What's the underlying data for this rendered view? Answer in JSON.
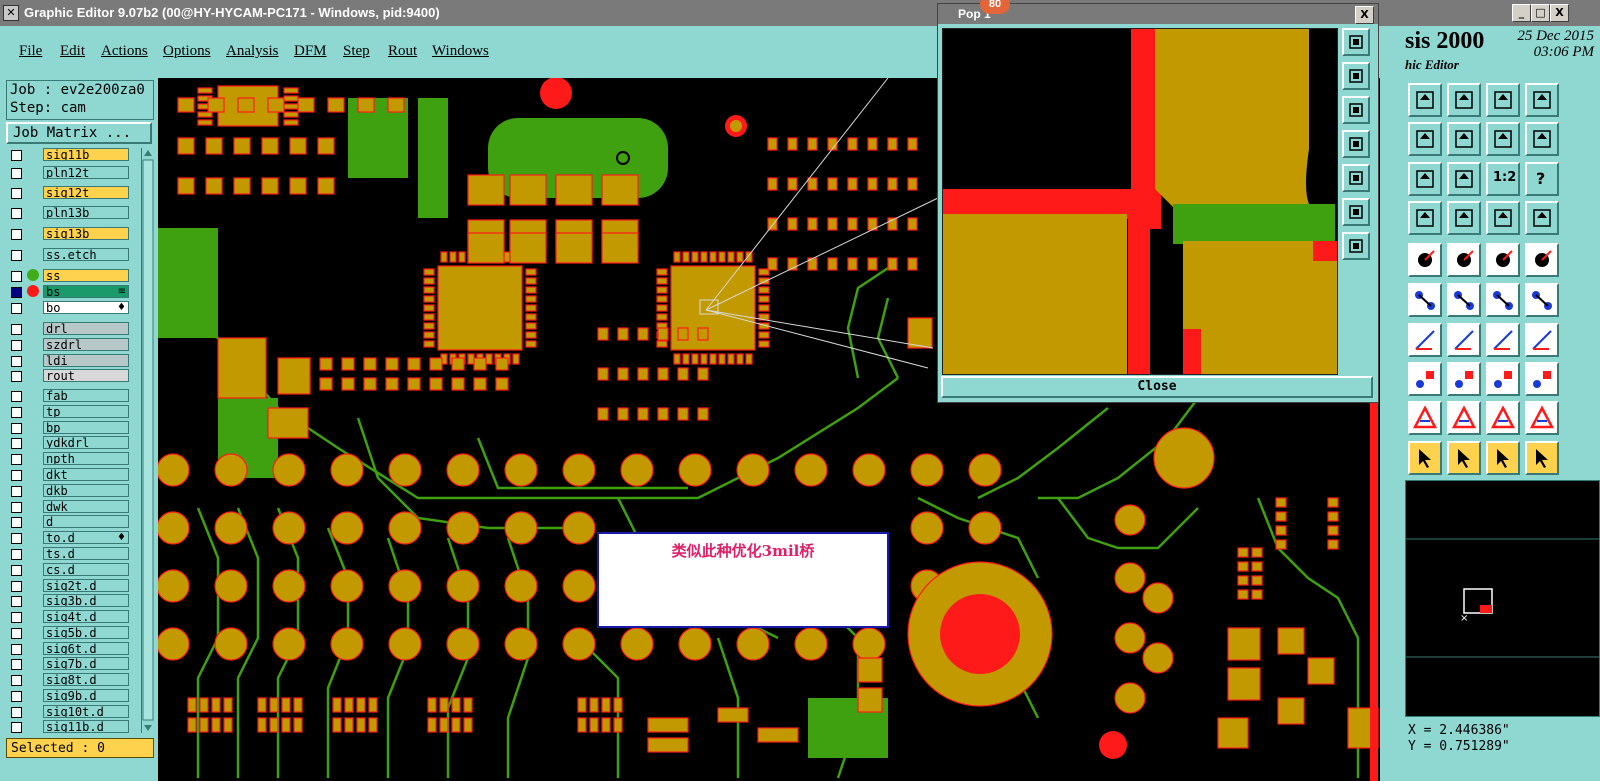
{
  "window": {
    "title": "Graphic Editor 9.07b2 (00@HY-HYCAM-PC171 - Windows, pid:9400)",
    "btn_min": "_",
    "btn_max": "□",
    "btn_close": "X"
  },
  "menu": [
    "File",
    "Edit",
    "Actions",
    "Options",
    "Analysis",
    "DFM",
    "Step",
    "Rout",
    "Windows"
  ],
  "app": {
    "name": "sis 2000",
    "subtitle": "hic Editor",
    "date": "25 Dec 2015",
    "time": "03:06 PM"
  },
  "job": {
    "job_line": "Job : ev2e200za0",
    "step_line": "Step: cam",
    "matrix_button": "Job Matrix ..."
  },
  "layers": [
    {
      "name": "sig11b",
      "color": "#ffd24d"
    },
    {
      "name": "pln12t",
      "color": "#8fd8d2"
    },
    {
      "name": "sig12t",
      "color": "#ffd24d"
    },
    {
      "name": "pln13b",
      "color": "#8fd8d2"
    },
    {
      "name": "sig13b",
      "color": "#ffd24d"
    },
    {
      "name": "ss.etch",
      "color": "#8fd8d2"
    },
    {
      "name": "ss",
      "color": "#ffd24d",
      "dot": "#3fae1a"
    },
    {
      "name": "bs",
      "color": "#1a9a6a",
      "dot": "#ff1a1a",
      "mark": "≡",
      "checked": true
    },
    {
      "name": "bo",
      "color": "#ffffff",
      "mark": "♦"
    },
    {
      "name": "drl",
      "color": "#b8c8c8"
    },
    {
      "name": "szdrl",
      "color": "#b8c8c8"
    },
    {
      "name": "ldi",
      "color": "#b8c8c8"
    },
    {
      "name": "rout",
      "color": "#d8d8d8"
    },
    {
      "name": "fab",
      "color": "#8fd8d2"
    },
    {
      "name": "tp",
      "color": "#8fd8d2"
    },
    {
      "name": "bp",
      "color": "#8fd8d2"
    },
    {
      "name": "ydkdrl",
      "color": "#8fd8d2"
    },
    {
      "name": "npth",
      "color": "#8fd8d2"
    },
    {
      "name": "dkt",
      "color": "#8fd8d2"
    },
    {
      "name": "dkb",
      "color": "#8fd8d2"
    },
    {
      "name": "dwk",
      "color": "#8fd8d2"
    },
    {
      "name": "d",
      "color": "#8fd8d2"
    },
    {
      "name": "to.d",
      "color": "#8fd8d2",
      "mark": "♦"
    },
    {
      "name": "ts.d",
      "color": "#8fd8d2"
    },
    {
      "name": "cs.d",
      "color": "#8fd8d2"
    },
    {
      "name": "sig2t.d",
      "color": "#8fd8d2"
    },
    {
      "name": "sig3b.d",
      "color": "#8fd8d2"
    },
    {
      "name": "sig4t.d",
      "color": "#8fd8d2"
    },
    {
      "name": "sig5b.d",
      "color": "#8fd8d2"
    },
    {
      "name": "sig6t.d",
      "color": "#8fd8d2"
    },
    {
      "name": "sig7b.d",
      "color": "#8fd8d2"
    },
    {
      "name": "sig8t.d",
      "color": "#8fd8d2"
    },
    {
      "name": "sig9b.d",
      "color": "#8fd8d2"
    },
    {
      "name": "sig10t.d",
      "color": "#8fd8d2"
    },
    {
      "name": "sig11b.d",
      "color": "#8fd8d2"
    }
  ],
  "selected": "Selected : 0",
  "note": "类似此种优化3mil桥",
  "popup": {
    "title": "Pop      1",
    "badge": "80",
    "close_label": "Close",
    "close_x": "X"
  },
  "toolbar": {
    "label_12": "1:2",
    "label_q": "?"
  },
  "coords": {
    "x": "X = 2.446386\"",
    "y": "Y = 0.751289\""
  },
  "colors": {
    "copper": "#c29a00",
    "board": "#000000",
    "mask": "#3fa010",
    "drill": "#ff1a1a",
    "panel": "#8fd8d2"
  }
}
